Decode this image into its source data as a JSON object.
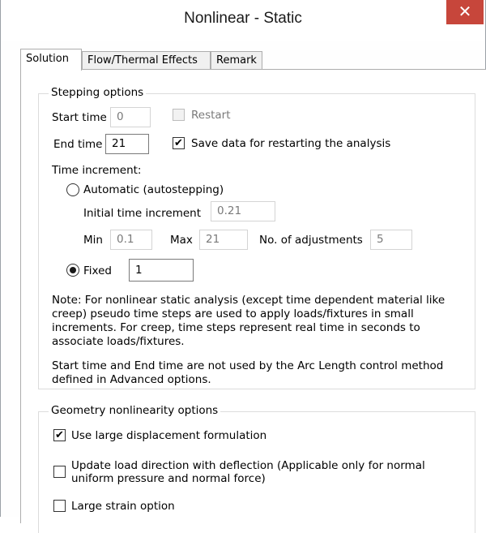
{
  "window": {
    "title": "Nonlinear - Static",
    "close_glyph": "✕"
  },
  "tabs": [
    {
      "label": "Solution",
      "active": true
    },
    {
      "label": "Flow/Thermal Effects",
      "active": false
    },
    {
      "label": "Remark",
      "active": false
    }
  ],
  "stepping": {
    "group_label": "Stepping options",
    "start_time_label": "Start time",
    "start_time_value": "0",
    "restart_label": "Restart",
    "restart_checked": false,
    "end_time_label": "End time",
    "end_time_value": "21",
    "save_data_label": "Save data for restarting the analysis",
    "save_data_checked": true,
    "time_increment_label": "Time increment:",
    "automatic_label": "Automatic (autostepping)",
    "automatic_selected": false,
    "initial_increment_label": "Initial time increment",
    "initial_increment_value": "0.21",
    "min_label": "Min",
    "min_value": "0.1",
    "max_label": "Max",
    "max_value": "21",
    "adjustments_label": "No. of adjustments",
    "adjustments_value": "5",
    "fixed_label": "Fixed",
    "fixed_selected": true,
    "fixed_value": "1",
    "note_lines": [
      "Note: For nonlinear static analysis (except time dependent material like",
      "creep) pseudo time steps are used to apply loads/fixtures in small",
      "increments. For creep, time steps represent real time in seconds to",
      "associate loads/fixtures."
    ],
    "note2_lines": [
      "Start time and End time  are not used by the Arc Length control method",
      "defined in Advanced options."
    ]
  },
  "geometry": {
    "group_label": "Geometry nonlinearity options",
    "large_disp_label": "Use large displacement formulation",
    "large_disp_checked": true,
    "update_load_lines": [
      "Update load direction with deflection (Applicable only for normal",
      "uniform pressure and normal force)"
    ],
    "update_load_checked": false,
    "large_strain_label": "Large strain option",
    "large_strain_checked": false
  },
  "check_glyph": "✔"
}
